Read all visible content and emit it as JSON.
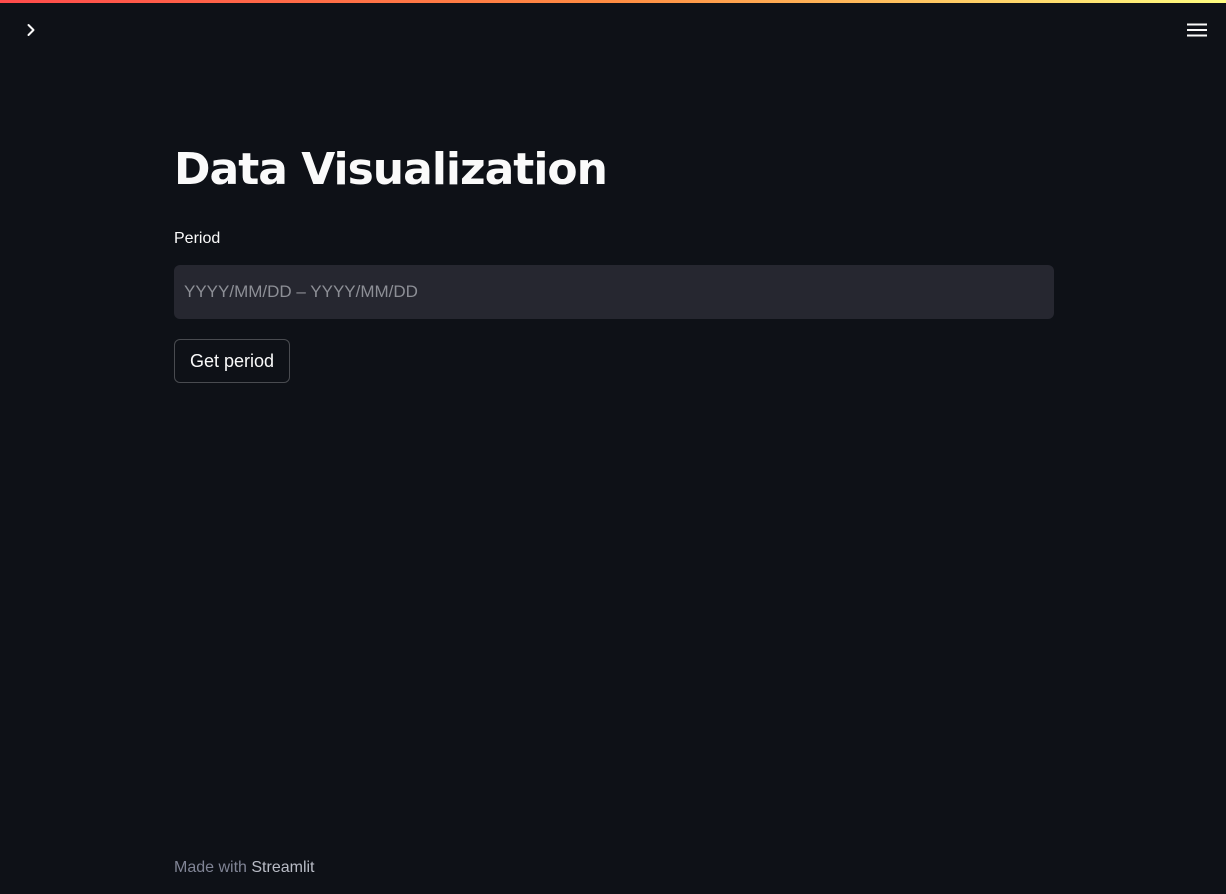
{
  "app": {
    "accent_gradient": [
      "#ff4b4b",
      "#fffd80"
    ],
    "background_color": "#0e1117"
  },
  "header": {
    "sidebar_toggle_icon": "chevron-right-icon",
    "menu_icon": "hamburger-menu-icon"
  },
  "main": {
    "title": "Data Visualization",
    "period": {
      "label": "Period",
      "value": "",
      "placeholder": "YYYY/MM/DD – YYYY/MM/DD"
    },
    "get_period_button": "Get period"
  },
  "footer": {
    "prefix": "Made with ",
    "link_text": "Streamlit"
  }
}
